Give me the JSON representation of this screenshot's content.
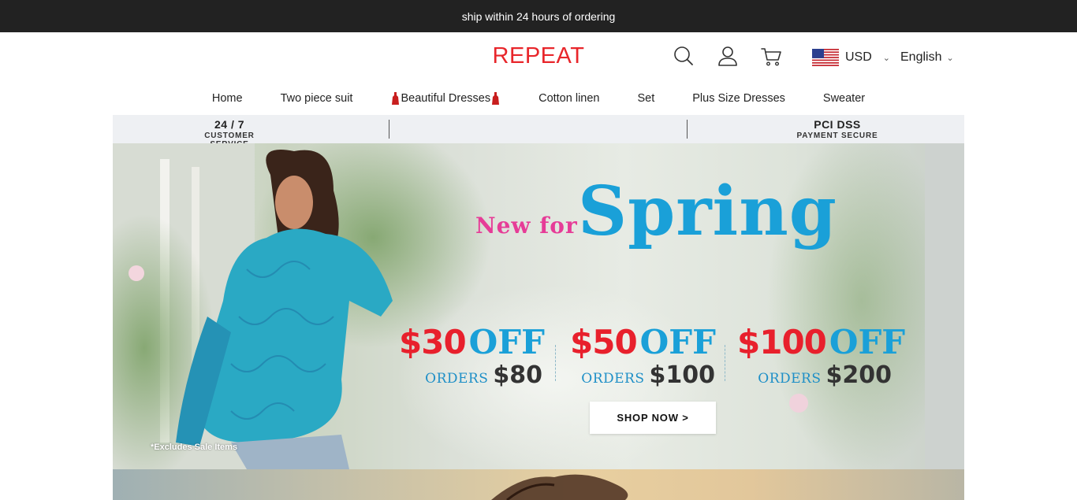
{
  "announcement": "ship within 24 hours of ordering",
  "header": {
    "logo": "REPEAT",
    "currency": "USD",
    "language": "English",
    "icons": [
      "search-icon",
      "account-icon",
      "cart-icon",
      "us-flag-icon",
      "chevron-down-icon"
    ]
  },
  "nav": {
    "items": [
      {
        "label": "Home"
      },
      {
        "label": "Two piece suit"
      },
      {
        "label": "Beautiful Dresses"
      },
      {
        "label": "Cotton linen"
      },
      {
        "label": "Set"
      },
      {
        "label": "Plus Size Dresses"
      },
      {
        "label": "Sweater"
      }
    ]
  },
  "trust": {
    "left_big": "24 / 7",
    "left_small": "CUSTOMER SERVICE",
    "right_big": "PCI DSS",
    "right_small": "PAYMENT SECURE"
  },
  "hero": {
    "new_for": "New for",
    "spring": "Spring",
    "offers": [
      {
        "amount": "$30",
        "off": "OFF",
        "orders": "ORDERS",
        "min": "$80"
      },
      {
        "amount": "$50",
        "off": "OFF",
        "orders": "ORDERS",
        "min": "$100"
      },
      {
        "amount": "$100",
        "off": "OFF",
        "orders": "ORDERS",
        "min": "$200"
      }
    ],
    "shop_now": "SHOP NOW >",
    "exclusion": "*Excludes Sale Items"
  },
  "colors": {
    "brand_red": "#e8262b",
    "announce_bg": "#222222",
    "spring_blue": "#1aa0d8",
    "new_for_pink": "#e63c97",
    "offer_red": "#e8202c",
    "trust_bg": "#eef0f3"
  }
}
